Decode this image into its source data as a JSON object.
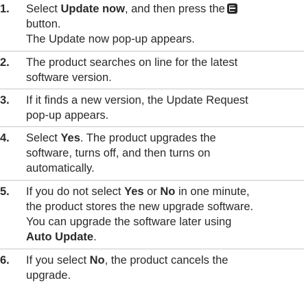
{
  "steps": [
    {
      "number": "1.",
      "lines": [
        {
          "pre": "Select ",
          "bold": "Update now",
          "post": ", and then press the"
        },
        {
          "text": "button."
        },
        {
          "text": "The Update now pop-up appears."
        }
      ],
      "icon": "enter-button-icon"
    },
    {
      "number": "2.",
      "lines": [
        {
          "text": "The product searches on line for the latest"
        },
        {
          "text": "software version."
        }
      ]
    },
    {
      "number": "3.",
      "lines": [
        {
          "text": "If it finds a new version, the Update Request"
        },
        {
          "text": "pop-up appears."
        }
      ]
    },
    {
      "number": "4.",
      "lines": [
        {
          "pre": "Select ",
          "bold": "Yes",
          "post": ". The product upgrades the"
        },
        {
          "text": "software, turns off, and then turns on"
        },
        {
          "text": "automatically."
        }
      ]
    },
    {
      "number": "5.",
      "lines": [
        {
          "pre": "If you do not select ",
          "bold": "Yes",
          "mid": " or ",
          "bold2": "No",
          "post": " in one minute,"
        },
        {
          "text": "the product stores the new upgrade software."
        },
        {
          "text": "You can upgrade the software later using"
        },
        {
          "bold": "Auto Update",
          "post": "."
        }
      ]
    },
    {
      "number": "6.",
      "lines": [
        {
          "pre": "If you select ",
          "bold": "No",
          "post": ", the product cancels the"
        },
        {
          "text": "upgrade."
        }
      ]
    }
  ]
}
